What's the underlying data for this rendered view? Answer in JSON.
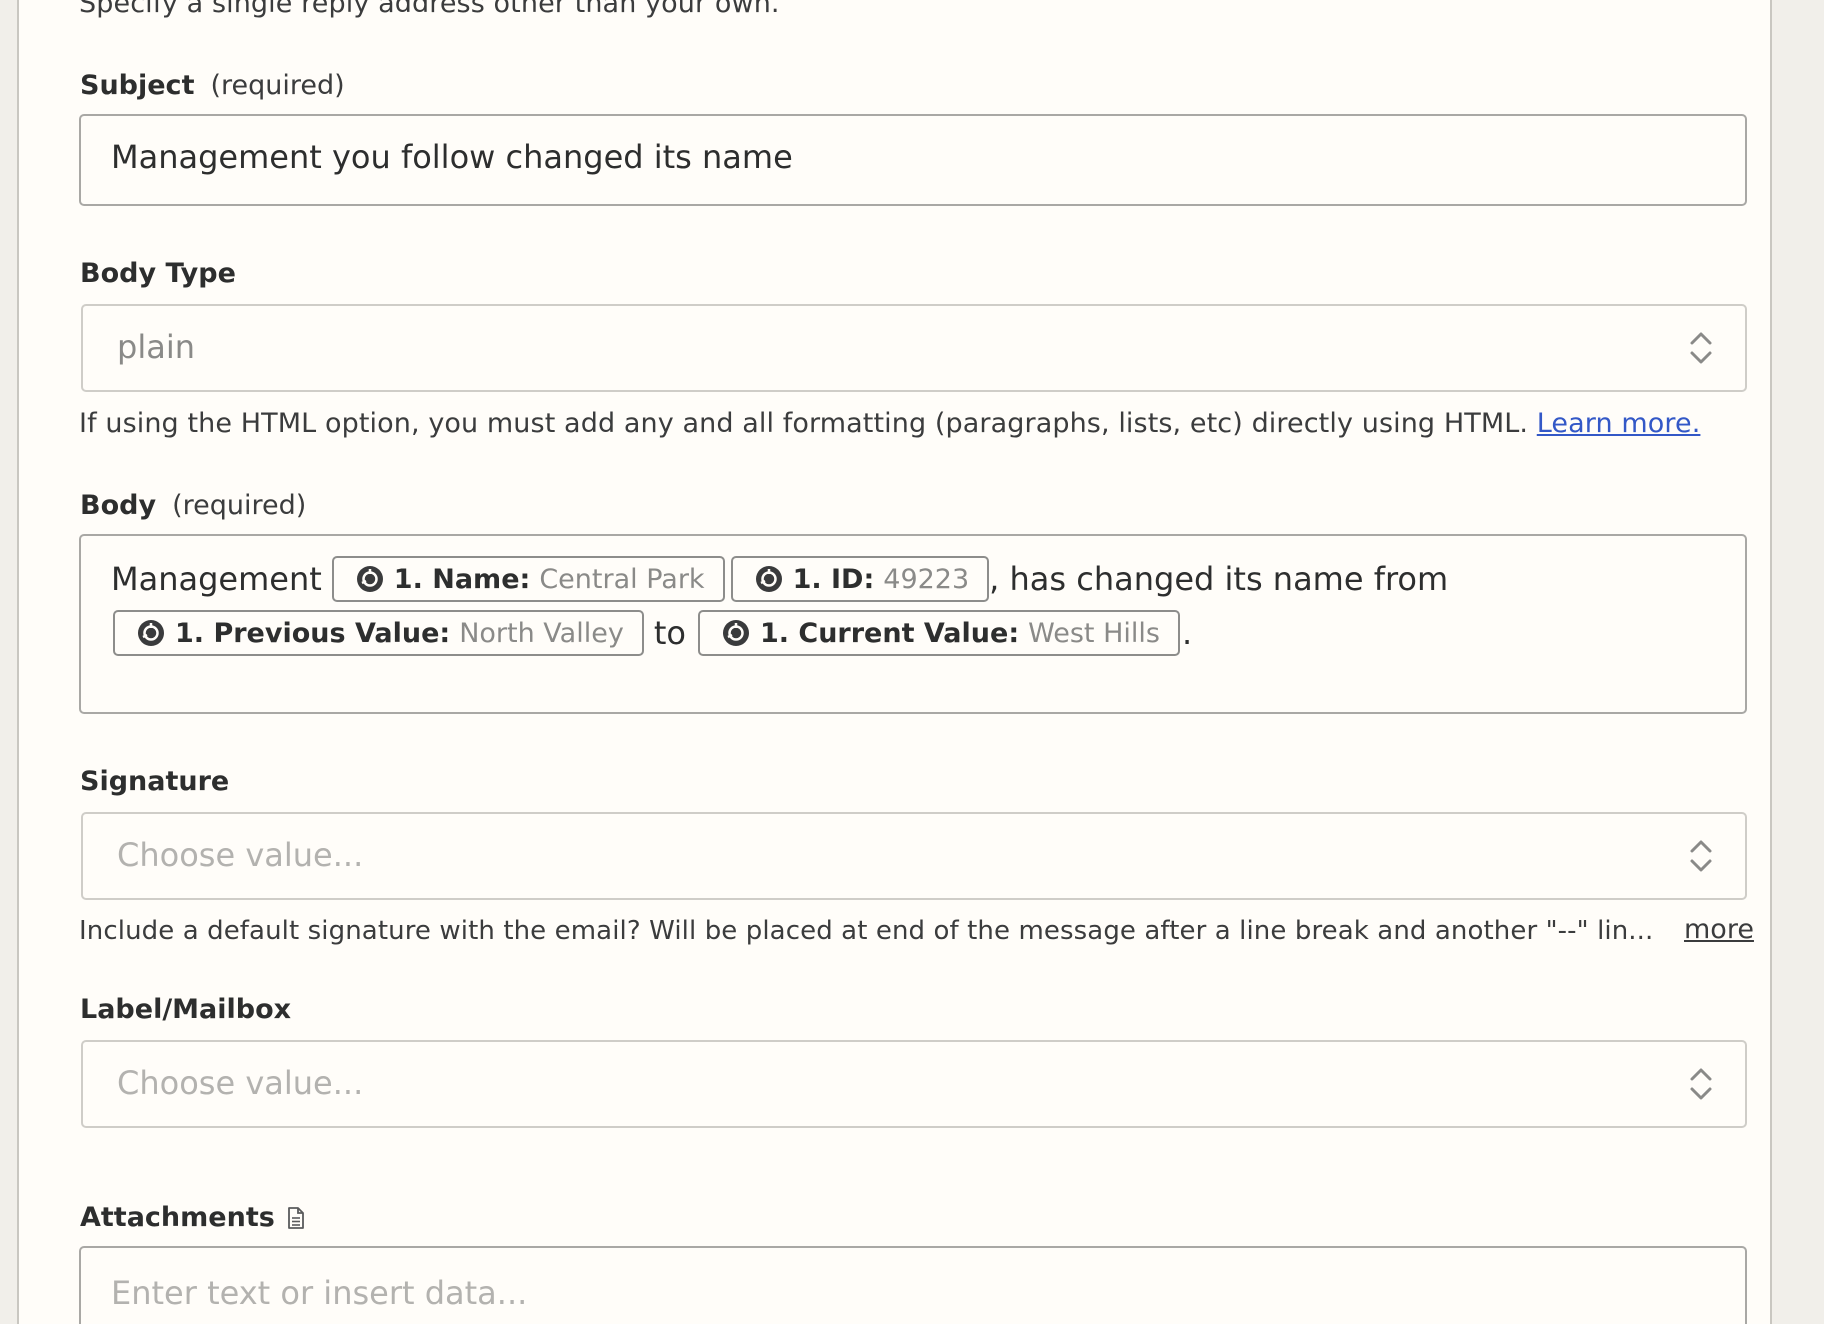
{
  "reply_to": {
    "helper": "Specify a single reply address other than your own."
  },
  "subject": {
    "label": "Subject",
    "required": "(required)",
    "value": "Management you follow changed its name"
  },
  "body_type": {
    "label": "Body Type",
    "value": "plain",
    "helper": "If using the HTML option, you must add any and all formatting (paragraphs, lists, etc) directly using HTML.",
    "link": "Learn more."
  },
  "body": {
    "label": "Body",
    "required": "(required)",
    "text_start": "Management",
    "pill_name_key": "1. Name:",
    "pill_name_value": "Central Park",
    "pill_id_key": "1. ID:",
    "pill_id_value": "49223",
    "text_mid": ", has changed its name from",
    "pill_prev_key": "1. Previous Value:",
    "pill_prev_value": "North Valley",
    "text_to": "to",
    "pill_curr_key": "1. Current Value:",
    "pill_curr_value": "West Hills",
    "text_end": "."
  },
  "signature": {
    "label": "Signature",
    "placeholder": "Choose value...",
    "helper": "Include a default signature with the email? Will be placed at end of the message after a line break and another \"--\" lin...",
    "more": "more"
  },
  "label_mailbox": {
    "label": "Label/Mailbox",
    "placeholder": "Choose value..."
  },
  "attachments": {
    "label": "Attachments",
    "icon": "file-icon",
    "placeholder": "Enter text or insert data..."
  }
}
